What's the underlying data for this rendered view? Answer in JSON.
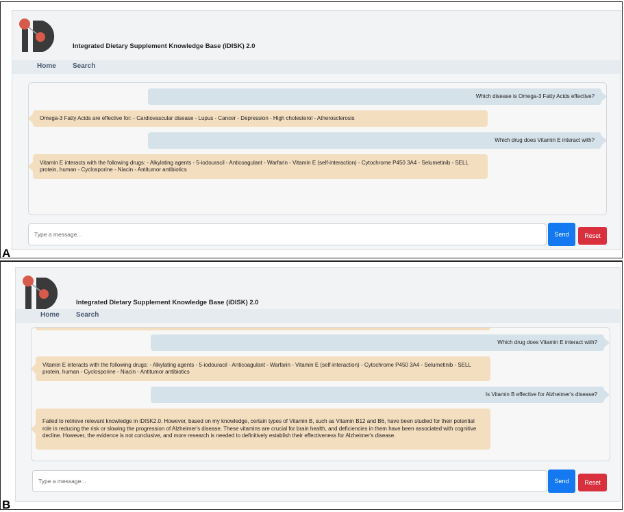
{
  "app": {
    "title": "Integrated Dietary Supplement Knowledge Base (iDISK) 2.0",
    "nav": [
      "Home",
      "Search"
    ]
  },
  "colors": {
    "user_bubble": "#d5e2ea",
    "bot_bubble": "#f4dec0",
    "send_button": "#1479f0",
    "reset_button": "#d9303e",
    "logo_dark": "#3a3a3a",
    "logo_accent": "#d85a4a"
  },
  "icons": [
    "idisk-logo-icon"
  ],
  "panels": {
    "a": {
      "label": "A",
      "messages": [
        {
          "role": "user",
          "text": "Which disease is Omega-3 Fatty Acids effective?"
        },
        {
          "role": "bot",
          "text": "Omega-3 Fatty Acids are effective for: - Cardiovascular disease - Lupus - Cancer - Depression - High cholesterol - Atherosclerosis"
        },
        {
          "role": "user",
          "text": "Which drug does Vitamin E interact with?"
        },
        {
          "role": "bot",
          "text": "Vitamin E interacts with the following drugs: - Alkylating agents - 5-iodouracil - Anticoagulant - Warfarin - Vitamin E (self-interaction) - Cytochrome P450 3A4 - Selumetinib - SELL protein, human - Cyclosporine - Niacin - Antitumor antibiotics"
        }
      ],
      "input_placeholder": "Type a message...",
      "send_label": "Send",
      "reset_label": "Reset"
    },
    "b": {
      "label": "B",
      "messages": [
        {
          "role": "user",
          "text": "Which drug does Vitamin E interact with?"
        },
        {
          "role": "bot",
          "text": "Vitamin E interacts with the following drugs: - Alkylating agents - 5-iodouracil - Anticoagulant - Warfarin - Vitamin E (self-interaction) - Cytochrome P450 3A4 - Selumetinib - SELL protein, human - Cyclosporine - Niacin - Antitumor antibiotics"
        },
        {
          "role": "user",
          "text": "Is Vitamin B effective for Alzheimer's disease?"
        },
        {
          "role": "bot",
          "text": "Failed to retrieve relevant knowledge in iDISK2.0. However, based on my knowledge, certain types of Vitamin B, such as Vitamin B12 and B6, have been studied for their potential role in reducing the risk or slowing the progression of Alzheimer's disease. These vitamins are crucial for brain health, and deficiencies in them have been associated with cognitive decline. However, the evidence is not conclusive, and more research is needed to definitively establish their effectiveness for Alzheimer's disease."
        }
      ],
      "input_placeholder": "Type a message...",
      "send_label": "Send",
      "reset_label": "Reset"
    }
  }
}
